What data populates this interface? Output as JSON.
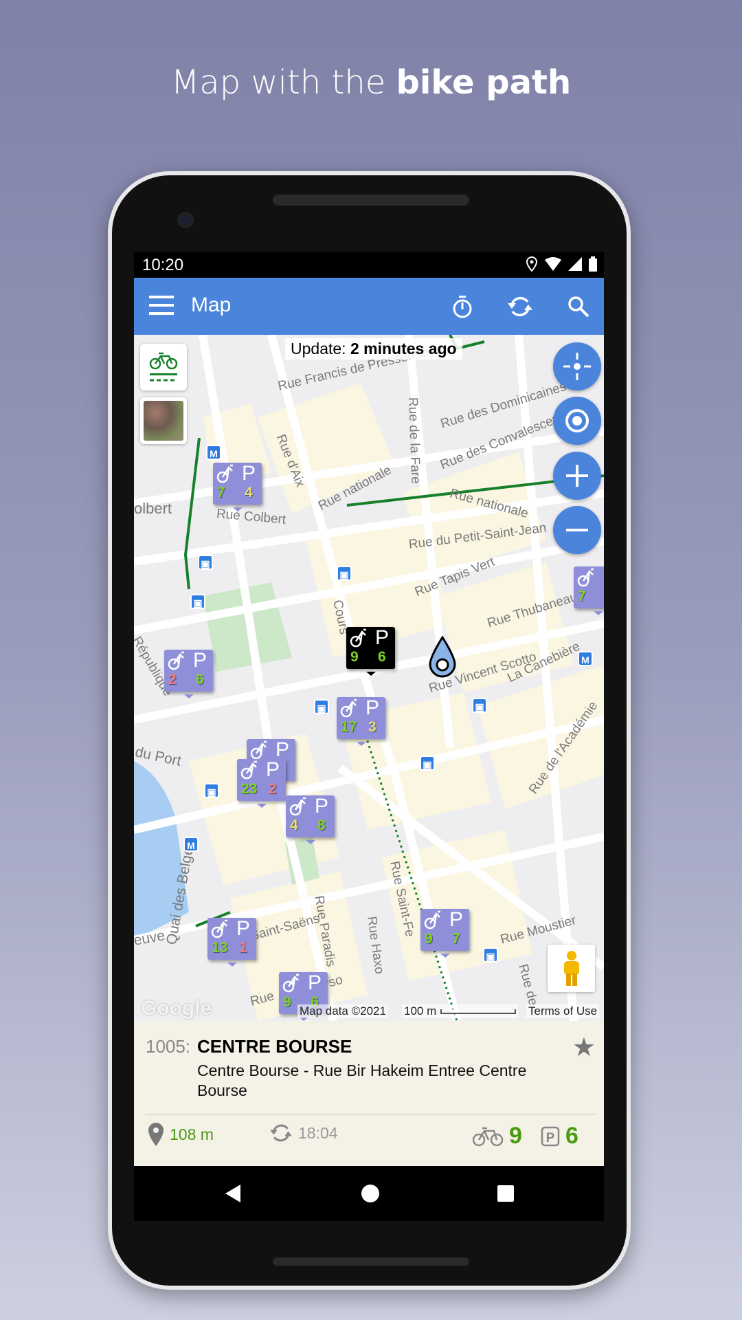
{
  "headline": {
    "normal": "Map with the ",
    "bold": "bike path"
  },
  "status_bar": {
    "time": "10:20",
    "icons": [
      "location-icon",
      "wifi-icon",
      "signal-icon",
      "battery-icon"
    ]
  },
  "app_bar": {
    "title": "Map",
    "actions": [
      "timer-icon",
      "refresh-icon",
      "search-icon"
    ],
    "color": "#4a84db"
  },
  "map": {
    "update_label": "Update:",
    "update_value": "2 minutes ago",
    "streets": [
      "Rue Francis de Pressensé",
      "Rue des Dominicaines",
      "Rue des Convalescents",
      "Rue d'Aix",
      "Rue de la Fare",
      "Rue nationale",
      "Rue nationale",
      "Rue Colbert",
      "olbert",
      "Rue du Petit-Saint-Jean",
      "Rue Tapis Vert",
      "Rue Thubaneau",
      "Cours",
      "Rue Vincent Scotto",
      "La Canebière",
      "Rue de l'Académie",
      "du Port",
      "Quai des Belges",
      "République",
      "Rue Saint-Fe",
      "Rue Paradis",
      "Rue Haxo",
      "Rue Moustier",
      "Saint-Saëns",
      "euve",
      "Rue de",
      "Rue",
      "vso"
    ],
    "markers": [
      {
        "bikes": "7",
        "stands": "4",
        "bike_color": "#7ed321",
        "stand_color": "#e8e070",
        "selected": false
      },
      {
        "bikes": "9",
        "stands": "6",
        "bike_color": "#7ed321",
        "stand_color": "#7ed321",
        "selected": true
      },
      {
        "bikes": "2",
        "stands": "6",
        "bike_color": "#f07a7a",
        "stand_color": "#7ed321",
        "selected": false
      },
      {
        "bikes": "17",
        "stands": "3",
        "bike_color": "#7ed321",
        "stand_color": "#e8e070",
        "selected": false
      },
      {
        "bikes": "",
        "stands": "",
        "bike_color": "#7ed321",
        "stand_color": "#7ed321",
        "selected": false
      },
      {
        "bikes": "23",
        "stands": "2",
        "bike_color": "#7ed321",
        "stand_color": "#f07a7a",
        "selected": false
      },
      {
        "bikes": "4",
        "stands": "8",
        "bike_color": "#e8e070",
        "stand_color": "#7ed321",
        "selected": false
      },
      {
        "bikes": "13",
        "stands": "1",
        "bike_color": "#7ed321",
        "stand_color": "#f07a7a",
        "selected": false
      },
      {
        "bikes": "9",
        "stands": "7",
        "bike_color": "#7ed321",
        "stand_color": "#7ed321",
        "selected": false
      },
      {
        "bikes": "9",
        "stands": "6",
        "bike_color": "#7ed321",
        "stand_color": "#7ed321",
        "selected": false
      },
      {
        "bikes": "7",
        "stands": "",
        "bike_color": "#7ed321",
        "stand_color": "#7ed321",
        "selected": false
      }
    ],
    "marker_p": "P",
    "attribution": {
      "google": "Google",
      "map_data": "Map data ©2021",
      "scale": "100 m",
      "terms": "Terms of Use"
    },
    "controls": [
      "center-icon",
      "my-location-icon",
      "zoom-in-icon",
      "zoom-out-icon"
    ]
  },
  "station": {
    "number": "1005:",
    "name": "CENTRE BOURSE",
    "address": "Centre Bourse - Rue Bir Hakeim Entree Centre Bourse",
    "distance": "108 m",
    "updated": "18:04",
    "bikes": "9",
    "stands": "6",
    "green": "#4a9a12"
  },
  "nav": [
    "back-icon",
    "home-icon",
    "recents-icon"
  ]
}
